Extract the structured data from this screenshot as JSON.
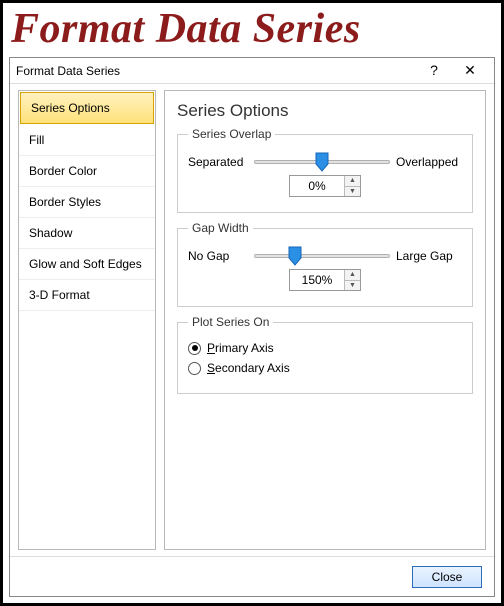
{
  "banner": "Format Data Series",
  "dialog": {
    "title": "Format Data Series",
    "help": "?",
    "close_glyph": "✕"
  },
  "sidebar": {
    "items": [
      "Series Options",
      "Fill",
      "Border Color",
      "Border Styles",
      "Shadow",
      "Glow and Soft Edges",
      "3-D Format"
    ]
  },
  "content": {
    "heading": "Series Options",
    "overlap": {
      "legend": "Series Overlap",
      "left": "Separated",
      "right": "Overlapped",
      "value": "0%",
      "pos": 50
    },
    "gap": {
      "legend": "Gap Width",
      "left": "No Gap",
      "right": "Large Gap",
      "value": "150%",
      "pos": 30
    },
    "plot_on": {
      "legend": "Plot Series On",
      "primary": "Primary Axis",
      "secondary": "Secondary Axis",
      "selected": "primary"
    }
  },
  "footer": {
    "close": "Close"
  }
}
